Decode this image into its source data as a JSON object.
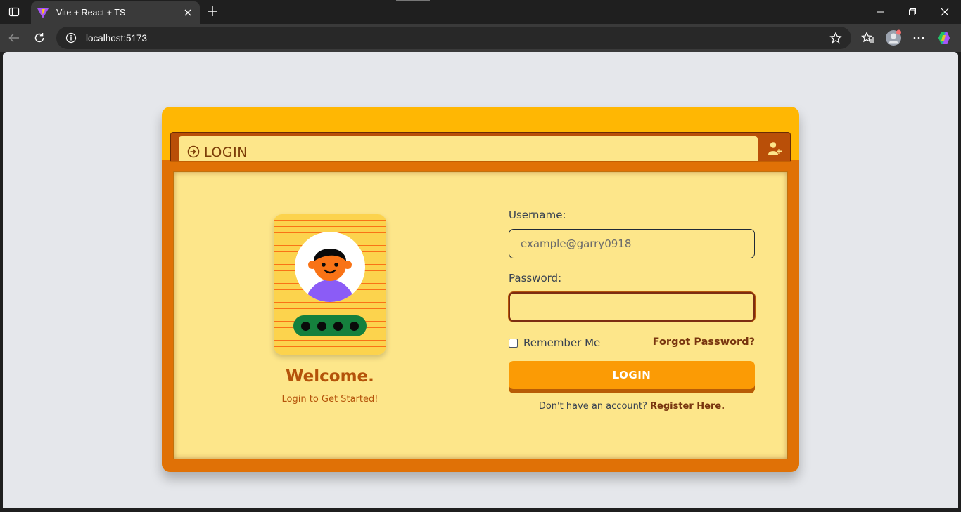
{
  "browser": {
    "tab_title": "Vite + React + TS",
    "url": "localhost:5173"
  },
  "card": {
    "header_title": "LOGIN",
    "welcome_title": "Welcome.",
    "welcome_subtitle": "Login to Get Started!"
  },
  "form": {
    "username_label": "Username:",
    "username_placeholder": "example@garry0918",
    "username_value": "",
    "password_label": "Password:",
    "password_value": "",
    "remember_label": "Remember Me",
    "remember_checked": false,
    "forgot_label": "Forgot Password?",
    "login_button": "LOGIN",
    "signup_prompt": "Don't have an account?",
    "signup_link": "Register Here."
  },
  "icons": {
    "sidebar_toggle": "sidebar-icon",
    "tab_favicon": "vite-logo-icon",
    "tab_close": "close-icon",
    "new_tab": "plus-icon",
    "back": "back-arrow-icon",
    "reload": "reload-icon",
    "site_info": "info-icon",
    "favorite": "star-icon",
    "favorites": "favorites-icon",
    "profile": "profile-icon",
    "more": "more-icon",
    "copilot": "copilot-icon",
    "login": "login-arrow-icon",
    "register": "user-plus-icon"
  },
  "colors": {
    "card_outer": "#ffb703",
    "card_frame": "#e07106",
    "panel": "#fde68a",
    "button": "#fb9b05",
    "accent_text": "#b4530a",
    "badge_pill": "#15803d"
  }
}
